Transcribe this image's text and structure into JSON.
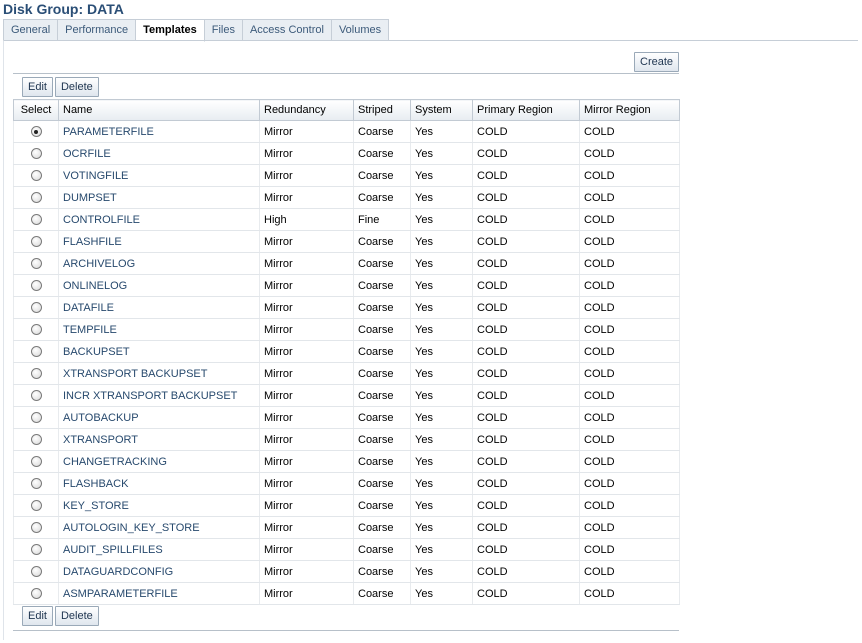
{
  "header": {
    "title": "Disk Group: DATA"
  },
  "tabs": [
    {
      "label": "General",
      "active": false
    },
    {
      "label": "Performance",
      "active": false
    },
    {
      "label": "Templates",
      "active": true
    },
    {
      "label": "Files",
      "active": false
    },
    {
      "label": "Access Control",
      "active": false
    },
    {
      "label": "Volumes",
      "active": false
    }
  ],
  "actions": {
    "create": "Create",
    "edit": "Edit",
    "delete": "Delete"
  },
  "table": {
    "columns": [
      "Select",
      "Name",
      "Redundancy",
      "Striped",
      "System",
      "Primary Region",
      "Mirror Region"
    ],
    "selected_index": 0,
    "rows": [
      {
        "name": "PARAMETERFILE",
        "redundancy": "Mirror",
        "striped": "Coarse",
        "system": "Yes",
        "primary": "COLD",
        "mirror": "COLD"
      },
      {
        "name": "OCRFILE",
        "redundancy": "Mirror",
        "striped": "Coarse",
        "system": "Yes",
        "primary": "COLD",
        "mirror": "COLD"
      },
      {
        "name": "VOTINGFILE",
        "redundancy": "Mirror",
        "striped": "Coarse",
        "system": "Yes",
        "primary": "COLD",
        "mirror": "COLD"
      },
      {
        "name": "DUMPSET",
        "redundancy": "Mirror",
        "striped": "Coarse",
        "system": "Yes",
        "primary": "COLD",
        "mirror": "COLD"
      },
      {
        "name": "CONTROLFILE",
        "redundancy": "High",
        "striped": "Fine",
        "system": "Yes",
        "primary": "COLD",
        "mirror": "COLD"
      },
      {
        "name": "FLASHFILE",
        "redundancy": "Mirror",
        "striped": "Coarse",
        "system": "Yes",
        "primary": "COLD",
        "mirror": "COLD"
      },
      {
        "name": "ARCHIVELOG",
        "redundancy": "Mirror",
        "striped": "Coarse",
        "system": "Yes",
        "primary": "COLD",
        "mirror": "COLD"
      },
      {
        "name": "ONLINELOG",
        "redundancy": "Mirror",
        "striped": "Coarse",
        "system": "Yes",
        "primary": "COLD",
        "mirror": "COLD"
      },
      {
        "name": "DATAFILE",
        "redundancy": "Mirror",
        "striped": "Coarse",
        "system": "Yes",
        "primary": "COLD",
        "mirror": "COLD"
      },
      {
        "name": "TEMPFILE",
        "redundancy": "Mirror",
        "striped": "Coarse",
        "system": "Yes",
        "primary": "COLD",
        "mirror": "COLD"
      },
      {
        "name": "BACKUPSET",
        "redundancy": "Mirror",
        "striped": "Coarse",
        "system": "Yes",
        "primary": "COLD",
        "mirror": "COLD"
      },
      {
        "name": "XTRANSPORT BACKUPSET",
        "redundancy": "Mirror",
        "striped": "Coarse",
        "system": "Yes",
        "primary": "COLD",
        "mirror": "COLD"
      },
      {
        "name": "INCR XTRANSPORT BACKUPSET",
        "redundancy": "Mirror",
        "striped": "Coarse",
        "system": "Yes",
        "primary": "COLD",
        "mirror": "COLD"
      },
      {
        "name": "AUTOBACKUP",
        "redundancy": "Mirror",
        "striped": "Coarse",
        "system": "Yes",
        "primary": "COLD",
        "mirror": "COLD"
      },
      {
        "name": "XTRANSPORT",
        "redundancy": "Mirror",
        "striped": "Coarse",
        "system": "Yes",
        "primary": "COLD",
        "mirror": "COLD"
      },
      {
        "name": "CHANGETRACKING",
        "redundancy": "Mirror",
        "striped": "Coarse",
        "system": "Yes",
        "primary": "COLD",
        "mirror": "COLD"
      },
      {
        "name": "FLASHBACK",
        "redundancy": "Mirror",
        "striped": "Coarse",
        "system": "Yes",
        "primary": "COLD",
        "mirror": "COLD"
      },
      {
        "name": "KEY_STORE",
        "redundancy": "Mirror",
        "striped": "Coarse",
        "system": "Yes",
        "primary": "COLD",
        "mirror": "COLD"
      },
      {
        "name": "AUTOLOGIN_KEY_STORE",
        "redundancy": "Mirror",
        "striped": "Coarse",
        "system": "Yes",
        "primary": "COLD",
        "mirror": "COLD"
      },
      {
        "name": "AUDIT_SPILLFILES",
        "redundancy": "Mirror",
        "striped": "Coarse",
        "system": "Yes",
        "primary": "COLD",
        "mirror": "COLD"
      },
      {
        "name": "DATAGUARDCONFIG",
        "redundancy": "Mirror",
        "striped": "Coarse",
        "system": "Yes",
        "primary": "COLD",
        "mirror": "COLD"
      },
      {
        "name": "ASMPARAMETERFILE",
        "redundancy": "Mirror",
        "striped": "Coarse",
        "system": "Yes",
        "primary": "COLD",
        "mirror": "COLD"
      }
    ]
  }
}
